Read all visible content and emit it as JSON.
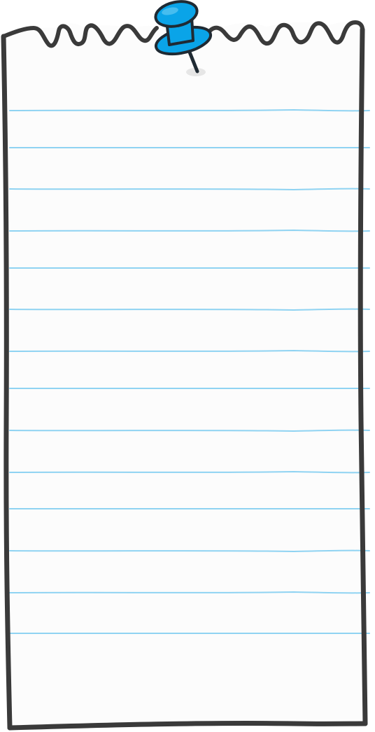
{
  "note": {
    "paper_color": "#fcfcfc",
    "outline_color": "#3a3a3a",
    "rule_color": "#8fd3f2",
    "ruled_line_count": 14
  },
  "pin": {
    "icon": "push-pin-icon",
    "color": "#0aa4e8",
    "outline_color": "#1f2a33",
    "shadow_color": "#e6e6e6"
  }
}
